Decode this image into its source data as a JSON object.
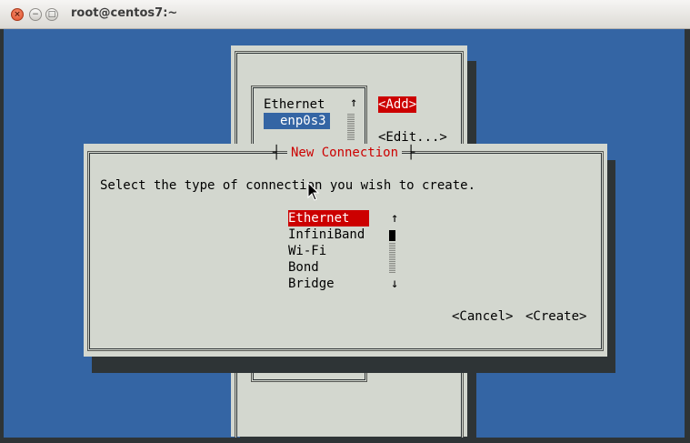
{
  "window": {
    "title": "root@centos7:~",
    "buttons": {
      "close": "×",
      "minimize": "−",
      "maximize": "□"
    }
  },
  "colors": {
    "terminal_bg": "#3465a4",
    "panel_bg": "#d3d7cf",
    "selection_red": "#cc0000",
    "shadow": "#2e3436"
  },
  "background_dialog": {
    "list_header": "Ethernet",
    "list_items": [
      "enp0s3"
    ],
    "buttons": {
      "add": "<Add>",
      "edit": "<Edit...>"
    },
    "scroll_up_icon": "↑"
  },
  "dialog": {
    "title": "New Connection",
    "prompt": "Select the type of connection you wish to create.",
    "options": [
      "Ethernet",
      "InfiniBand",
      "Wi-Fi",
      "Bond",
      "Bridge"
    ],
    "selected_index": 0,
    "scroll_up_icon": "↑",
    "scroll_down_icon": "↓",
    "title_decor_left": "┤",
    "title_decor_right": "├",
    "buttons": {
      "cancel": "<Cancel>",
      "create": "<Create>"
    }
  }
}
